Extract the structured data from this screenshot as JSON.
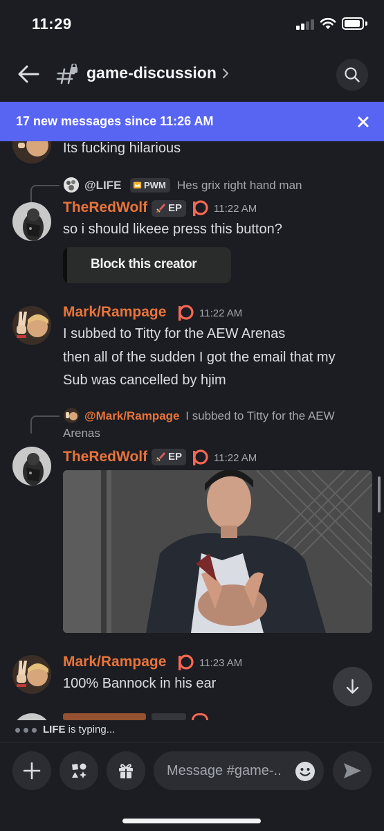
{
  "status_bar": {
    "time": "11:29"
  },
  "header": {
    "channel_name": "game-discussion"
  },
  "banner": {
    "text": "17 new messages since 11:26 AM"
  },
  "messages": [
    {
      "text": "Its fucking hilarious"
    },
    {
      "reply": {
        "name": "@LIFE",
        "tag": "PWM",
        "text": "Hes grix right hand man"
      },
      "author": "TheRedWolf",
      "tag": "EP",
      "time": "11:22 AM",
      "lines": [
        "so i should likeee press this button?"
      ],
      "embed_button_label": "Block this creator"
    },
    {
      "author": "Mark/Rampage",
      "time": "11:22 AM",
      "lines": [
        "I subbed to Titty for the AEW Arenas",
        "then all of the sudden I got the email that my",
        "Sub was cancelled by hjim"
      ]
    },
    {
      "reply": {
        "name": "@Mark/Rampage",
        "text_line1": "I subbed to Titty for the AEW",
        "text_line2": "Arenas"
      },
      "author": "TheRedWolf",
      "tag": "EP",
      "time": "11:22 AM"
    },
    {
      "author": "Mark/Rampage",
      "time": "11:23 AM",
      "lines": [
        "100% Bannock in his ear"
      ]
    }
  ],
  "typing": {
    "user": "LIFE",
    "suffix": "is typing..."
  },
  "composer": {
    "placeholder": "Message #game-.."
  },
  "colors": {
    "accent": "#5865f2",
    "username": "#e8743b",
    "background": "#1c1d22"
  }
}
